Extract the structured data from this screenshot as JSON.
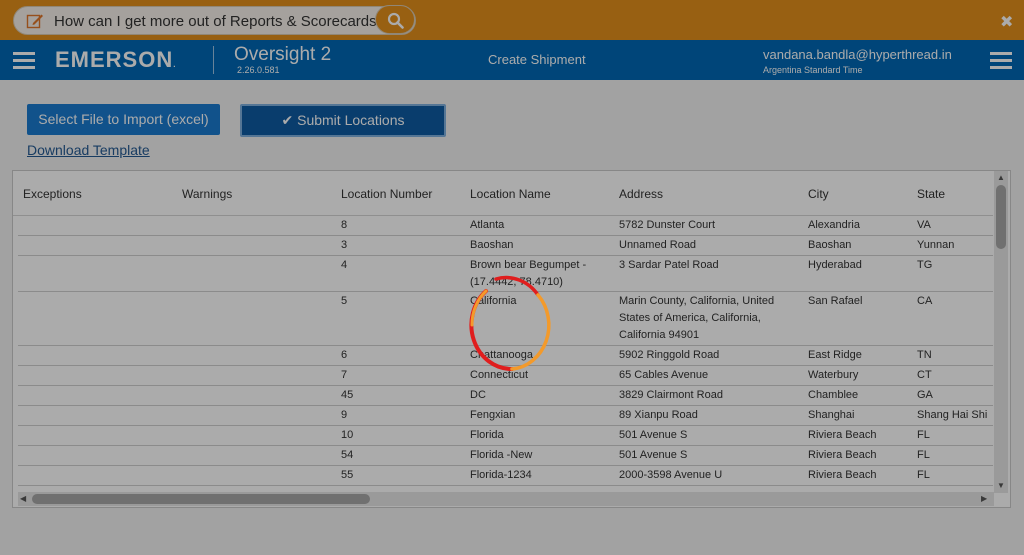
{
  "help_bar": {
    "question": "How can I get more out of Reports & Scorecards?",
    "icons": [
      "edit-icon",
      "search-icon",
      "close-icon"
    ]
  },
  "header": {
    "brand": "EMERSON",
    "brand_mark": ".",
    "app_name": "Oversight 2",
    "app_version": "2.26.0.581",
    "page_title": "Create Shipment",
    "user_email": "vandana.bandla@hyperthread.in",
    "user_timezone": "Argentina Standard Time"
  },
  "actions": {
    "import_label": "Select File to Import (excel)",
    "submit_label": "Submit Locations",
    "download_label": "Download Template"
  },
  "table": {
    "columns": [
      "Exceptions",
      "Warnings",
      "Location Number",
      "Location Name",
      "Address",
      "City",
      "State"
    ],
    "rows": [
      {
        "number": "8",
        "name": "Atlanta",
        "address": "5782 Dunster Court",
        "city": "Alexandria",
        "state": "VA"
      },
      {
        "number": "3",
        "name": "Baoshan",
        "address": "Unnamed Road",
        "city": "Baoshan",
        "state": "Yunnan"
      },
      {
        "number": "4",
        "name": "Brown bear Begumpet - (17.4442, 78.4710)",
        "address": "3 Sardar Patel Road",
        "city": "Hyderabad",
        "state": "TG"
      },
      {
        "number": "5",
        "name": "California",
        "address": "Marin County, California, United States of America, California, California 94901",
        "city": "San Rafael",
        "state": "CA"
      },
      {
        "number": "6",
        "name": "Chattanooga",
        "address": "5902 Ringgold Road",
        "city": "East Ridge",
        "state": "TN"
      },
      {
        "number": "7",
        "name": "Connecticut",
        "address": "65 Cables Avenue",
        "city": "Waterbury",
        "state": "CT"
      },
      {
        "number": "45",
        "name": "DC",
        "address": "3829 Clairmont Road",
        "city": "Chamblee",
        "state": "GA"
      },
      {
        "number": "9",
        "name": "Fengxian",
        "address": "89 Xianpu Road",
        "city": "Shanghai",
        "state": "Shang Hai Shi"
      },
      {
        "number": "10",
        "name": "Florida",
        "address": "501 Avenue S",
        "city": "Riviera Beach",
        "state": "FL"
      },
      {
        "number": "54",
        "name": "Florida -New",
        "address": "501 Avenue S",
        "city": "Riviera Beach",
        "state": "FL"
      },
      {
        "number": "55",
        "name": "Florida-1234",
        "address": "2000-3598 Avenue U",
        "city": "Riviera Beach",
        "state": "FL"
      }
    ]
  },
  "colors": {
    "help_bar": "#e38f1b",
    "header": "#0068b5",
    "primary_button": "#1a7bd0",
    "spinner_red": "#e01e1e",
    "spinner_orange": "#f39a2b"
  },
  "loading": true
}
